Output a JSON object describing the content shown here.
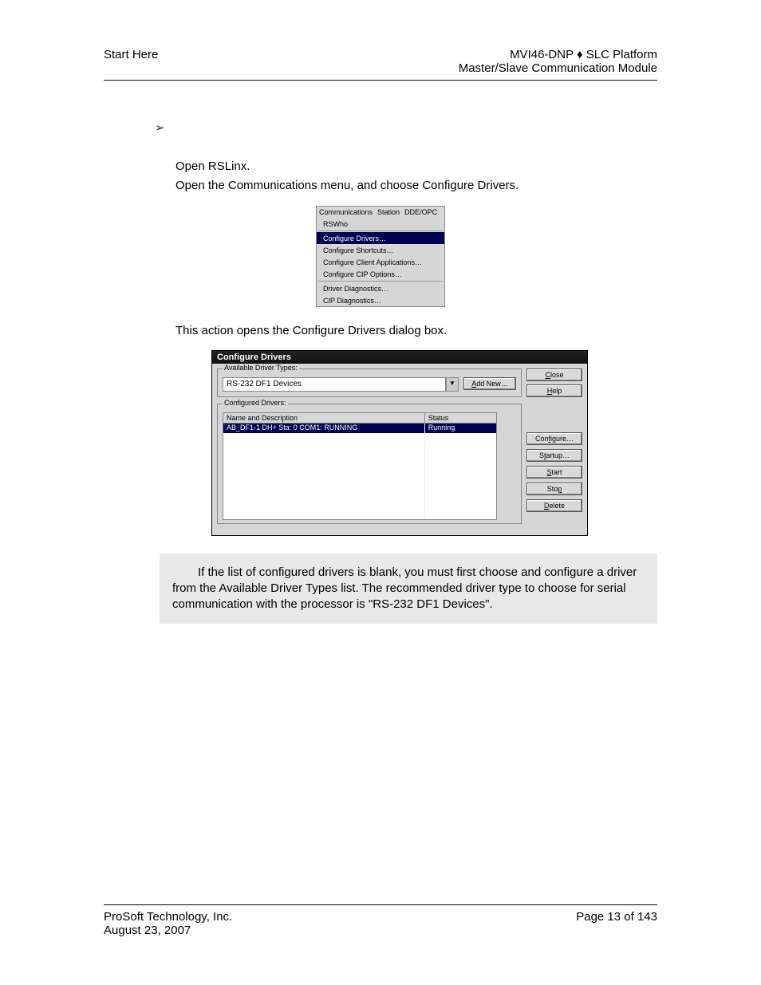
{
  "header": {
    "left": "Start Here",
    "right1": "MVI46-DNP ♦ SLC Platform",
    "right2": "Master/Slave Communication Module"
  },
  "steps": {
    "line1": "Open RSLinx.",
    "line2": "Open the Communications menu, and choose Configure Drivers."
  },
  "menu": {
    "bar": [
      "Communications",
      "Station",
      "DDE/OPC"
    ],
    "items_top": [
      "RSWho"
    ],
    "highlight": "Configure Drivers…",
    "items_mid": [
      "Configure Shortcuts…",
      "Configure Client Applications…",
      "Configure CIP Options…"
    ],
    "items_bot": [
      "Driver Diagnostics…",
      "CIP Diagnostics…"
    ]
  },
  "mid_text": "This action opens the Configure Drivers dialog box.",
  "dialog": {
    "title": "Configure Drivers",
    "group1_label": "Available Driver Types:",
    "combo_value": "RS-232 DF1 Devices",
    "add_new": "Add New…",
    "close": "Close",
    "help": "Help",
    "group2_label": "Configured Drivers:",
    "col1": "Name and Description",
    "col2": "Status",
    "row_name": "AB_DF1-1 DH+ Sta: 0 COM1: RUNNING",
    "row_status": "Running",
    "side": {
      "configure": "Configure…",
      "startup": "Startup…",
      "start": "Start",
      "stop": "Stop",
      "delete": "Delete"
    }
  },
  "note": "If the list of configured drivers is blank, you must first choose and configure a driver from the Available Driver Types list. The recommended driver type to choose for serial communication with the processor is \"RS-232 DF1 Devices\".",
  "footer": {
    "left1": "ProSoft Technology, Inc.",
    "left2": "August 23, 2007",
    "right": "Page 13 of 143"
  }
}
